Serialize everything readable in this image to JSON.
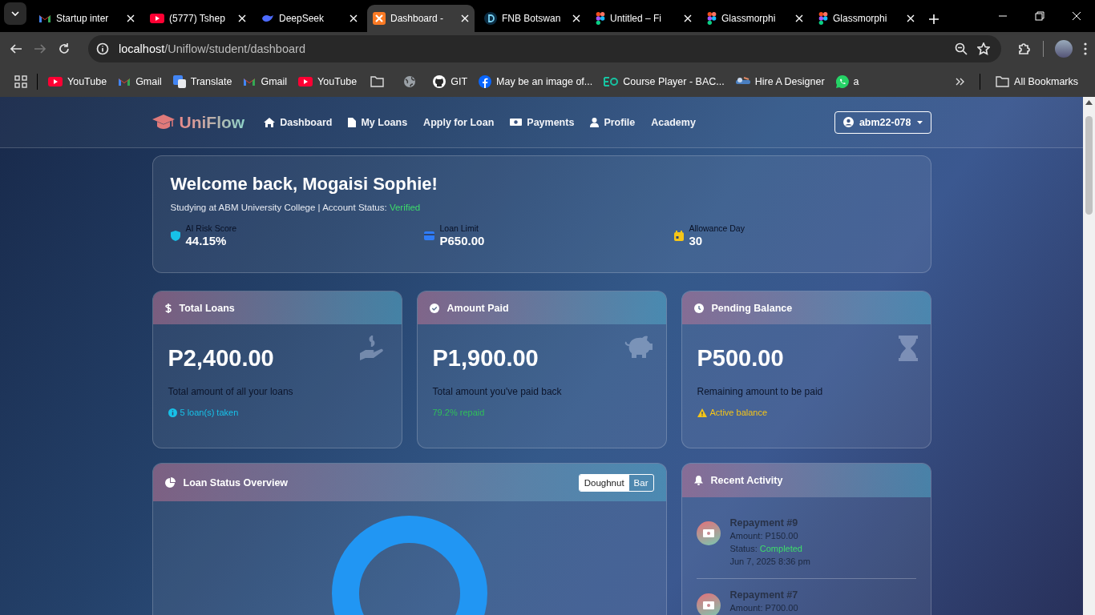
{
  "browser": {
    "tabs": [
      {
        "title": "Startup inter",
        "selected": false
      },
      {
        "title": "(5777) Tshep",
        "selected": false
      },
      {
        "title": "DeepSeek",
        "selected": false
      },
      {
        "title": "Dashboard -",
        "selected": true
      },
      {
        "title": "FNB Botswan",
        "selected": false
      },
      {
        "title": "Untitled – Fi",
        "selected": false
      },
      {
        "title": "Glassmorphi",
        "selected": false
      },
      {
        "title": "Glassmorphi",
        "selected": false
      }
    ],
    "address": {
      "host": "localhost",
      "path": "/Uniflow/student/dashboard"
    },
    "bookmarks": [
      {
        "kind": "link",
        "label": "YouTube"
      },
      {
        "kind": "link",
        "label": "Gmail"
      },
      {
        "kind": "link",
        "label": "Translate"
      },
      {
        "kind": "link",
        "label": "Gmail"
      },
      {
        "kind": "link",
        "label": "YouTube"
      },
      {
        "kind": "icon"
      },
      {
        "kind": "icon"
      },
      {
        "kind": "link",
        "label": "GIT"
      },
      {
        "kind": "link",
        "label": "May be an image of..."
      },
      {
        "kind": "link",
        "label": "Course Player - BAC..."
      },
      {
        "kind": "link",
        "label": "Hire A Designer"
      },
      {
        "kind": "link",
        "label": "a"
      }
    ],
    "all_bookmarks": "All Bookmarks"
  },
  "app": {
    "brand": "UniFlow",
    "nav": [
      {
        "label": "Dashboard"
      },
      {
        "label": "My Loans"
      },
      {
        "label": "Apply for Loan"
      },
      {
        "label": "Payments"
      },
      {
        "label": "Profile"
      },
      {
        "label": "Academy"
      }
    ],
    "user": "abm22-078",
    "welcome": {
      "title": "Welcome back, Mogaisi Sophie!",
      "subtitle": "Studying at ABM University College | Account Status: ",
      "status": "Verified",
      "metrics": [
        {
          "label": "AI Risk Score",
          "value": "44.15%",
          "color": "#17c1e8"
        },
        {
          "label": "Loan Limit",
          "value": "P650.00",
          "color": "#2f7cf6"
        },
        {
          "label": "Allowance Day",
          "value": "30",
          "color": "#f5c518"
        }
      ]
    },
    "stats": [
      {
        "title": "Total Loans",
        "value": "P2,400.00",
        "description": "Total amount of all your loans",
        "note": "5 loan(s) taken",
        "color": "#17c1e8"
      },
      {
        "title": "Amount Paid",
        "value": "P1,900.00",
        "description": "Total amount you've paid back",
        "note": "79.2% repaid",
        "color": "#2fbf5a"
      },
      {
        "title": "Pending Balance",
        "value": "P500.00",
        "description": "Remaining amount to be paid",
        "note": "Active balance",
        "color": "#f5c518"
      }
    ],
    "overview": {
      "title": "Loan Status Overview",
      "toggles": [
        {
          "label": "Doughnut",
          "selected": true
        },
        {
          "label": "Bar",
          "selected": false
        }
      ]
    },
    "activity": {
      "title": "Recent Activity",
      "items": [
        {
          "title": "Repayment #9",
          "amount": "Amount: P150.00",
          "status_label": "Status: ",
          "status": "Completed",
          "date": "Jun 7, 2025 8:36 pm"
        },
        {
          "title": "Repayment #7",
          "amount": "Amount: P700.00"
        }
      ]
    }
  }
}
